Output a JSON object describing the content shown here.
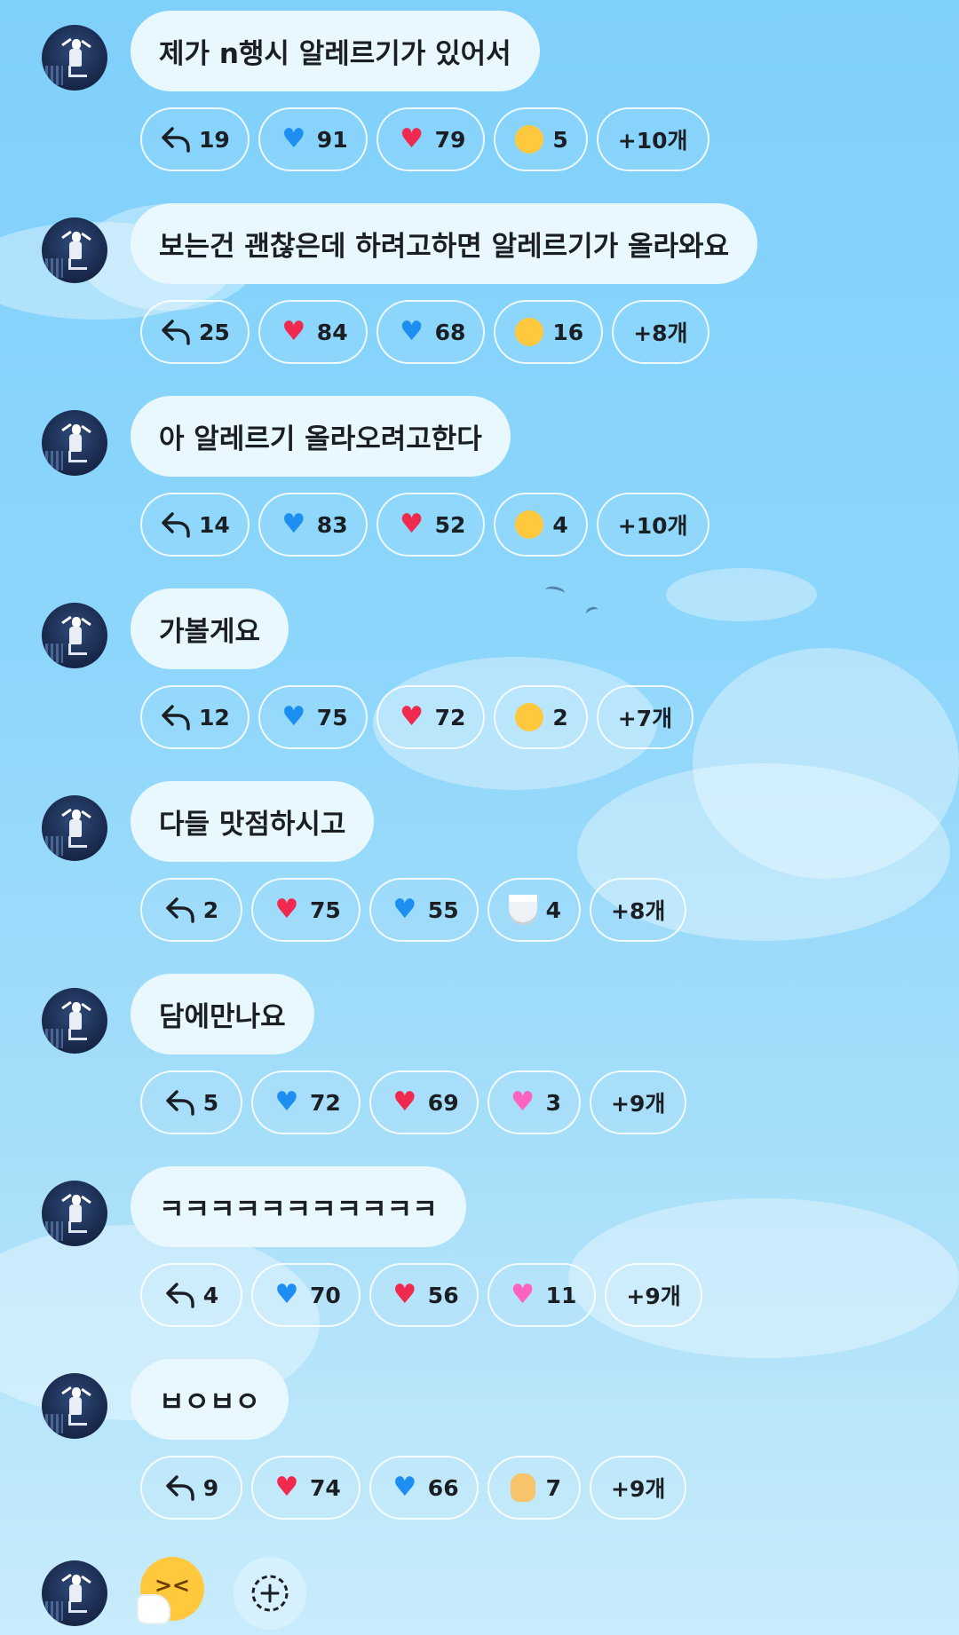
{
  "messages": [
    {
      "text": "제가 n행시 알레르기가 있어서",
      "reactions": [
        {
          "type": "reply",
          "count": "19"
        },
        {
          "type": "blue-heart",
          "count": "91"
        },
        {
          "type": "red-heart",
          "count": "79"
        },
        {
          "type": "smiling-face-with-hearts",
          "count": "5"
        },
        {
          "type": "more",
          "label": "+10개"
        }
      ]
    },
    {
      "text": "보는건 괜찮은데 하려고하면 알레르기가 올라와요",
      "reactions": [
        {
          "type": "reply",
          "count": "25"
        },
        {
          "type": "red-heart",
          "count": "84"
        },
        {
          "type": "blue-heart",
          "count": "68"
        },
        {
          "type": "face-with-tears-of-joy",
          "count": "16"
        },
        {
          "type": "more",
          "label": "+8개"
        }
      ]
    },
    {
      "text": "아 알레르기 올라오려고한다",
      "reactions": [
        {
          "type": "reply",
          "count": "14"
        },
        {
          "type": "blue-heart",
          "count": "83"
        },
        {
          "type": "red-heart",
          "count": "52"
        },
        {
          "type": "rolling-on-floor-laughing",
          "count": "4"
        },
        {
          "type": "more",
          "label": "+10개"
        }
      ]
    },
    {
      "text": "가볼게요",
      "reactions": [
        {
          "type": "reply",
          "count": "12"
        },
        {
          "type": "blue-heart",
          "count": "75"
        },
        {
          "type": "red-heart",
          "count": "72"
        },
        {
          "type": "rolling-on-floor-laughing",
          "count": "2"
        },
        {
          "type": "more",
          "label": "+7개"
        }
      ]
    },
    {
      "text": "다들 맛점하시고",
      "reactions": [
        {
          "type": "reply",
          "count": "2"
        },
        {
          "type": "red-heart",
          "count": "75"
        },
        {
          "type": "blue-heart",
          "count": "55"
        },
        {
          "type": "rice-bowl",
          "count": "4"
        },
        {
          "type": "more",
          "label": "+8개"
        }
      ]
    },
    {
      "text": "담에만나요",
      "reactions": [
        {
          "type": "reply",
          "count": "5"
        },
        {
          "type": "blue-heart",
          "count": "72"
        },
        {
          "type": "red-heart",
          "count": "69"
        },
        {
          "type": "pink-heart",
          "count": "3"
        },
        {
          "type": "more",
          "label": "+9개"
        }
      ]
    },
    {
      "text": "ㅋㅋㅋㅋㅋㅋㅋㅋㅋㅋㅋ",
      "reactions": [
        {
          "type": "reply",
          "count": "4"
        },
        {
          "type": "blue-heart",
          "count": "70"
        },
        {
          "type": "red-heart",
          "count": "56"
        },
        {
          "type": "pink-heart",
          "count": "11"
        },
        {
          "type": "more",
          "label": "+9개"
        }
      ]
    },
    {
      "text": "ㅂㅇㅂㅇ",
      "reactions": [
        {
          "type": "reply",
          "count": "9"
        },
        {
          "type": "red-heart",
          "count": "74"
        },
        {
          "type": "blue-heart",
          "count": "66"
        },
        {
          "type": "waving-hand",
          "count": "7"
        },
        {
          "type": "more",
          "label": "+9개"
        }
      ]
    }
  ],
  "final_message": {
    "emoji": "sneezing-face"
  },
  "colors": {
    "blue_heart": "#1e8ff2",
    "red_heart": "#f0294f",
    "pink_heart": "#ff63c2",
    "bubble": "#e9f8ff"
  }
}
